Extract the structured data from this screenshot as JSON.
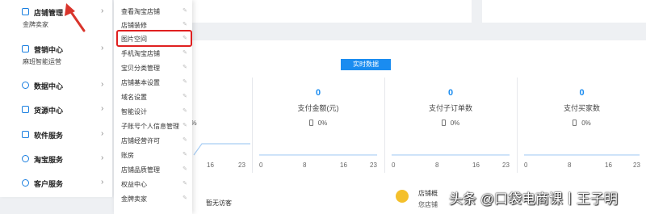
{
  "sidebar": {
    "items": [
      {
        "label": "店铺管理",
        "icon": "store-icon",
        "sub": "金牌卖家"
      },
      {
        "label": "营销中心",
        "icon": "marketing-icon",
        "sub": "麻班智能运营"
      },
      {
        "label": "数据中心",
        "icon": "data-icon"
      },
      {
        "label": "货源中心",
        "icon": "supply-icon"
      },
      {
        "label": "软件服务",
        "icon": "grid-icon"
      },
      {
        "label": "淘宝服务",
        "icon": "taobao-service-icon"
      },
      {
        "label": "客户服务",
        "icon": "customer-service-icon"
      }
    ]
  },
  "submenu": {
    "items": [
      {
        "label": "查看淘宝店铺"
      },
      {
        "label": "店铺装修"
      },
      {
        "label": "图片空间"
      },
      {
        "label": "手机淘宝店铺"
      },
      {
        "label": "宝贝分类管理"
      },
      {
        "label": "店铺基本设置"
      },
      {
        "label": "域名设置"
      },
      {
        "label": "智能设计"
      },
      {
        "label": "子账号个人信息管理"
      },
      {
        "label": "店铺经营许可"
      },
      {
        "label": "账房"
      },
      {
        "label": "店铺品质管理"
      },
      {
        "label": "权益中心"
      },
      {
        "label": "金牌卖家"
      }
    ],
    "highlighted_index": 2
  },
  "stats": {
    "tab_label": "实时数据",
    "cards": [
      {
        "value": "",
        "label": "数",
        "pct": "0%"
      },
      {
        "value": "0",
        "label": "支付金额(元)",
        "pct": "0%"
      },
      {
        "value": "0",
        "label": "支付子订单数",
        "pct": "0%"
      },
      {
        "value": "0",
        "label": "支付买家数",
        "pct": "0%"
      }
    ],
    "axis": [
      "0",
      "8",
      "16",
      "23"
    ]
  },
  "bottom": {
    "no_visitor": "暂无访客",
    "notice_title": "店铺概",
    "notice_sub": "您店铺"
  },
  "watermark": "头条 @口袋电商课丨王子明",
  "colors": {
    "accent": "#1a8cf0",
    "highlight": "#e02020",
    "arrow": "#d9342b"
  }
}
